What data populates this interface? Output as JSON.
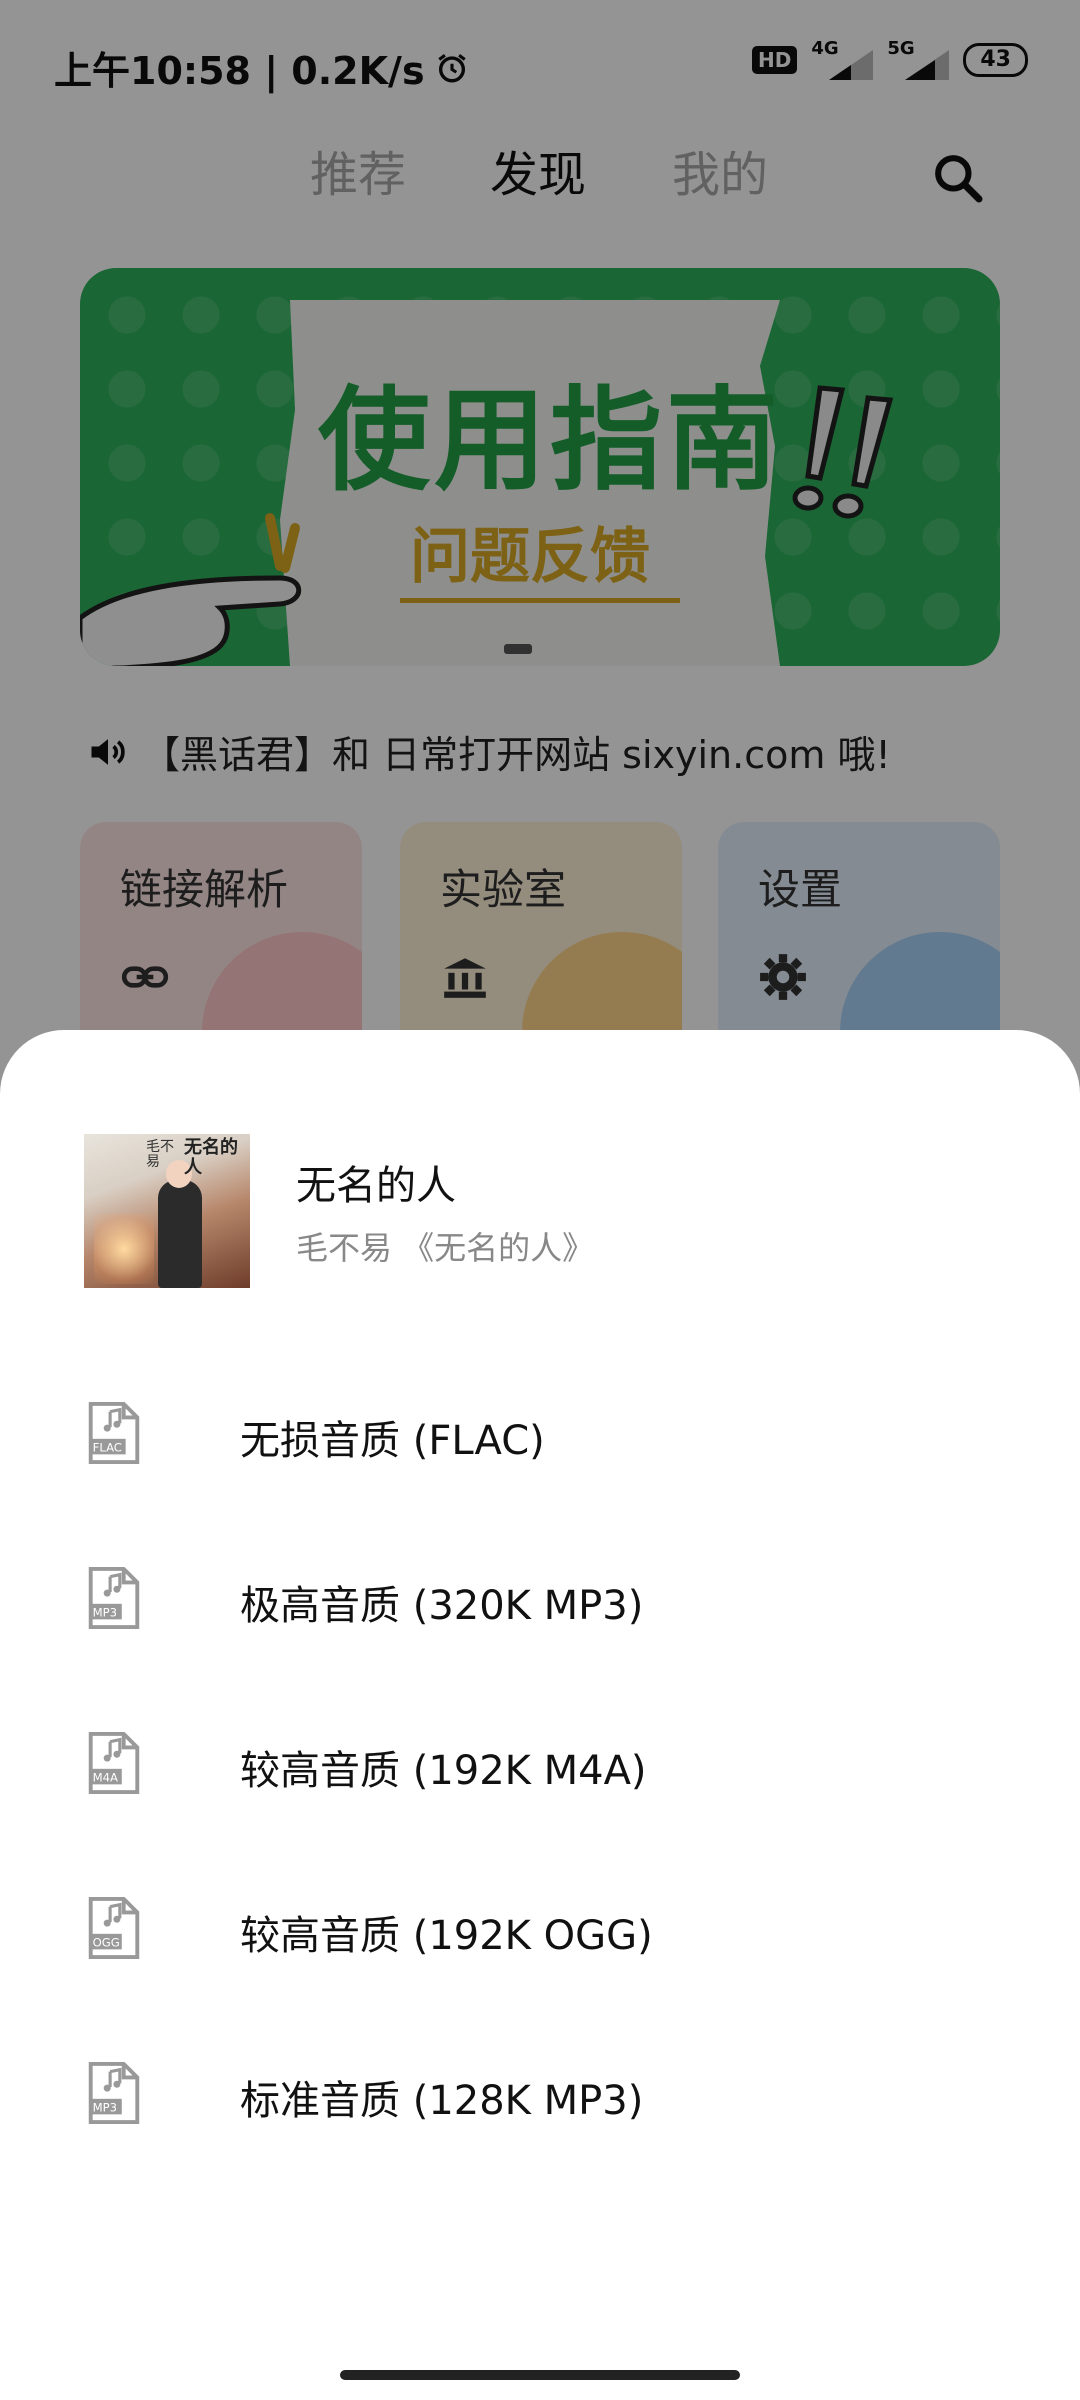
{
  "status_bar": {
    "time": "上午10:58 | 0.2K/s",
    "hd": "HD",
    "sig1": "4G",
    "sig2": "5G",
    "battery": "43"
  },
  "tabs": [
    {
      "label": "推荐",
      "active": false
    },
    {
      "label": "发现",
      "active": true
    },
    {
      "label": "我的",
      "active": false
    }
  ],
  "banner": {
    "title": "使用指南",
    "subtitle": "问题反馈"
  },
  "notice": "【黑话君】和 日常打开网站 sixyin.com 哦!",
  "cards": [
    {
      "title": "链接解析",
      "icon": "link-icon"
    },
    {
      "title": "实验室",
      "icon": "bank-icon"
    },
    {
      "title": "设置",
      "icon": "gear-icon"
    }
  ],
  "sheet": {
    "song": {
      "title": "无名的人",
      "subtitle": "毛不易 《无名的人》",
      "album_text": "无名的人",
      "album_text2": "毛不易"
    },
    "options": [
      {
        "label": "无损音质 (FLAC)",
        "icon_tag": "FLAC"
      },
      {
        "label": "极高音质 (320K MP3)",
        "icon_tag": "MP3"
      },
      {
        "label": "较高音质 (192K M4A)",
        "icon_tag": "M4A"
      },
      {
        "label": "较高音质 (192K OGG)",
        "icon_tag": "OGG"
      },
      {
        "label": "标准音质 (128K MP3)",
        "icon_tag": "MP3"
      }
    ]
  },
  "colors": {
    "banner_green": "#2db05a",
    "feedback_gold": "#d8a824",
    "overlay": "rgba(0,0,0,0.42)"
  }
}
